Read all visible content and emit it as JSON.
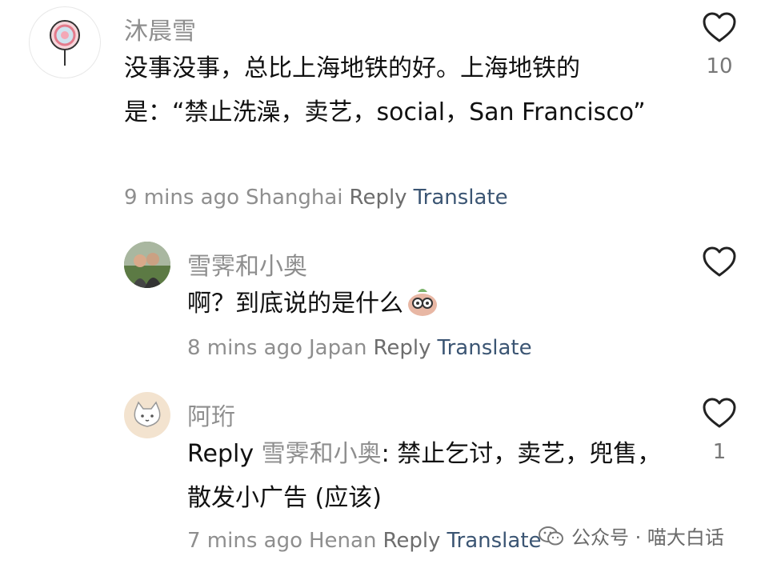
{
  "comments": [
    {
      "username": "沐晨雪",
      "text": "没事没事，总比上海地铁的好。上海地铁的是：“禁止洗澡，卖艺，social，San Francisco”",
      "time": "9 mins ago",
      "location": "Shanghai",
      "reply": "Reply",
      "translate": "Translate",
      "likes": "10",
      "avatar_icon": "lollipop-icon"
    },
    {
      "username": "雪霁和小奥",
      "text": "啊？到底说的是什么",
      "time": "8 mins ago",
      "location": "Japan",
      "reply": "Reply",
      "translate": "Translate",
      "likes": "",
      "avatar_icon": "couple-photo"
    },
    {
      "username": "阿珩",
      "reply_prefix": "Reply",
      "mention": "雪霁和小奥",
      "text": ": 禁止乞讨，卖艺，兜售，散发小广告 (应该)",
      "time": "7 mins ago",
      "location": "Henan",
      "reply": "Reply",
      "translate": "Translate",
      "likes": "1",
      "avatar_icon": "cat-icon"
    }
  ],
  "watermark": {
    "icon": "wechat-icon",
    "text": "公众号 · 喵大白话"
  },
  "colors": {
    "meta": "#8e8e8e",
    "translate": "#3b5573",
    "text": "#111111"
  }
}
